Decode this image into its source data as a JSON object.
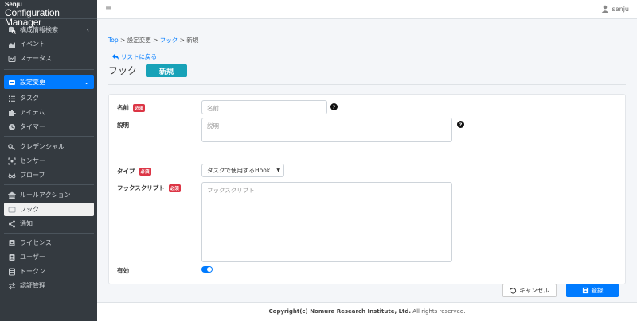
{
  "brand": {
    "line1": "Senju",
    "line2": "Configuration Manager"
  },
  "sidebar": {
    "items": [
      {
        "label": "構成情報検索",
        "icon": "database-search-icon",
        "chevron": "‹"
      },
      {
        "label": "イベント",
        "icon": "chart-area-icon"
      },
      {
        "label": "ステータス",
        "icon": "status-icon"
      },
      {
        "label": "設定変更",
        "icon": "settings-change-icon",
        "chevron": "⌄",
        "active": true
      },
      {
        "label": "タスク",
        "icon": "task-list-icon"
      },
      {
        "label": "アイテム",
        "icon": "puzzle-icon"
      },
      {
        "label": "タイマー",
        "icon": "clock-icon"
      },
      {
        "label": "クレデンシャル",
        "icon": "key-icon"
      },
      {
        "label": "センサー",
        "icon": "sensor-icon"
      },
      {
        "label": "プローブ",
        "icon": "glasses-icon"
      },
      {
        "label": "ルールアクション",
        "icon": "building-icon"
      },
      {
        "label": "フック",
        "icon": "hook-icon",
        "current": true
      },
      {
        "label": "通知",
        "icon": "share-icon"
      },
      {
        "label": "ライセンス",
        "icon": "license-icon"
      },
      {
        "label": "ユーザー",
        "icon": "user-badge-icon"
      },
      {
        "label": "トークン",
        "icon": "token-icon"
      },
      {
        "label": "認証管理",
        "icon": "exchange-icon"
      }
    ]
  },
  "topbar": {
    "menu_glyph": "≡",
    "username": "senju"
  },
  "breadcrumb": {
    "home": "Top",
    "sep1": " > ",
    "level1": "設定変更",
    "sep2": " > ",
    "level2": "フック",
    "sep3": " > ",
    "current": "新規"
  },
  "back_link": "リストに戻る",
  "page_title": "フック",
  "badge": "新規",
  "form": {
    "required_label": "必須",
    "name_label": "名前",
    "name_placeholder": "名前",
    "desc_label": "説明",
    "desc_placeholder": "説明",
    "type_label": "タイプ",
    "type_value": "タスクで使用するHook",
    "script_label": "フックスクリプト",
    "script_placeholder": "フックスクリプト",
    "enabled_label": "有効",
    "enabled": true,
    "help_glyph": "?"
  },
  "buttons": {
    "cancel": "キャンセル",
    "save": "登録"
  },
  "footer": {
    "copyright": "Copyright(c) Nomura Research Institute, Ltd.",
    "rights": " All rights reserved."
  },
  "colors": {
    "sidebar_bg": "#343a40",
    "accent": "#007bff",
    "badge_bg": "#17a2b8",
    "required_bg": "#dc3545"
  }
}
